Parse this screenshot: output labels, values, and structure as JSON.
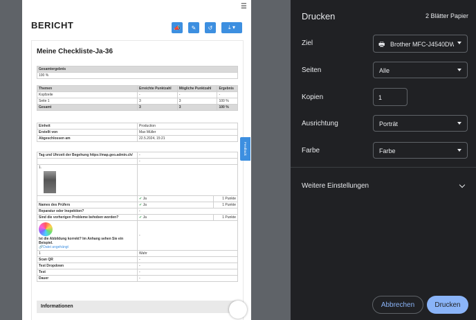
{
  "report": {
    "brand": "BERICHT",
    "menu_icon": "hamburger-icon",
    "toolbar_icons": [
      "megaphone-icon",
      "edit-icon",
      "history-icon",
      "download-icon"
    ],
    "title": "Meine Checkliste-Ja-36",
    "overall": {
      "label": "Gesamtergebnis",
      "value": "100 %"
    },
    "themes": {
      "headers": [
        "Themen",
        "Erreichte Punktzahl",
        "Mögliche Punktzahl",
        "Ergebnis"
      ],
      "rows": [
        [
          "Kopfzeile",
          "-",
          "-",
          "-"
        ],
        [
          "Seite 1",
          "3",
          "3",
          "100 %"
        ]
      ],
      "total": [
        "Gesamt",
        "3",
        "3",
        "100 %"
      ]
    },
    "meta": [
      {
        "k": "Einheit",
        "v": "Production"
      },
      {
        "k": "Erstellt von",
        "v": "Max Müller"
      },
      {
        "k": "Abgeschlossen am",
        "v": "22.5.2024, 15:21"
      }
    ],
    "q": {
      "inspection_time": "Tag und Uhrzeit der Begehung https://map.geo.admin.ch/",
      "dash": "-",
      "photo_index": "1.",
      "ja": "Ja",
      "punkte": "1 Punkte",
      "inspector": "Names des Prüfers",
      "repair": "Reparatur oder Inspektion?",
      "problems": "Sind die vorherigen Probleme behoben worden?",
      "image_question": "Ist die Abbildung korrekt? Im Anhang sehen Sie ein Beispiel.",
      "attachment": "Datei angehängt",
      "one": "1",
      "wahr": "Wahr",
      "scan": "Scan QR",
      "dropdown": "Test Dropdown",
      "test": "Test",
      "dauer": "Dauer"
    },
    "info_section": "Informationen",
    "feedback": "Feedback"
  },
  "print": {
    "title": "Drucken",
    "sheets": "2 Blätter Papier",
    "labels": {
      "destination": "Ziel",
      "pages": "Seiten",
      "copies": "Kopien",
      "orientation": "Ausrichtung",
      "color": "Farbe"
    },
    "destination_value": "Brother MFC-J4540DW",
    "destination_icon": "printer-icon",
    "pages_value": "Alle",
    "copies_value": "1",
    "orientation_value": "Porträt",
    "color_value": "Farbe",
    "more_settings": "Weitere Einstellungen",
    "cancel": "Abbrechen",
    "print": "Drucken",
    "colors": {
      "panel_bg": "#202124",
      "accent": "#8ab4f8",
      "toolbar_blue": "#3d8fe0"
    }
  }
}
